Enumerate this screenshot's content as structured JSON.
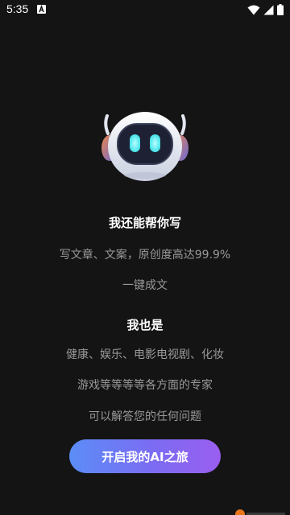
{
  "status_bar": {
    "time": "5:35",
    "notification_icon": "font-a-icon",
    "icons": [
      "wifi-icon",
      "signal-icon",
      "battery-icon"
    ]
  },
  "hero": {
    "mascot_icon": "robot-icon"
  },
  "intro": {
    "heading": "我还能帮你写",
    "line1": "写文章、文案，原创度高达99.9%",
    "line2": "一键成文"
  },
  "about": {
    "heading": "我也是",
    "line1": "健康、娱乐、电影电视剧、化妆",
    "line2": "游戏等等等等各方面的专家",
    "line3": "可以解答您的任何问题"
  },
  "cta": {
    "label": "开启我的AI之旅"
  },
  "colors": {
    "background": "#141414",
    "text_primary": "#ffffff",
    "text_secondary": "#9a9a9a",
    "button_gradient_start": "#5b8df6",
    "button_gradient_end": "#9a5ef0",
    "robot_eye": "#5ef0f0"
  }
}
